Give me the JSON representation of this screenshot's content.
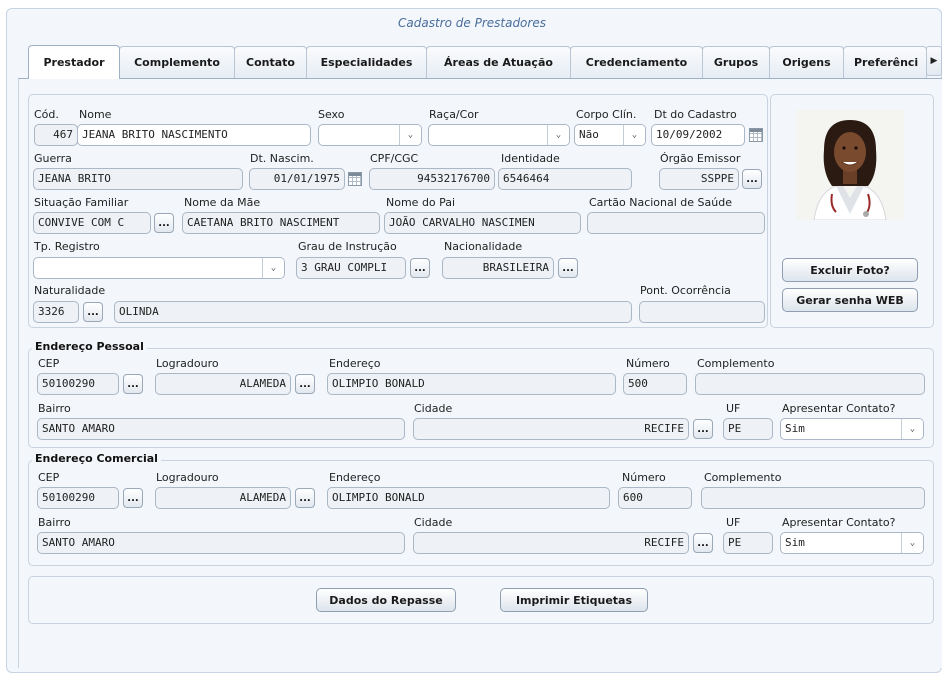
{
  "title": "Cadastro de Prestadores",
  "tabs": [
    "Prestador",
    "Complemento",
    "Contato",
    "Especialidades",
    "Áreas de Atuação",
    "Credenciamento",
    "Grupos",
    "Origens",
    "Preferênci"
  ],
  "labels": {
    "cod": "Cód.",
    "nome": "Nome",
    "sexo": "Sexo",
    "raca": "Raça/Cor",
    "corpo": "Corpo Clín.",
    "dt_cadastro": "Dt do Cadastro",
    "guerra": "Guerra",
    "dt_nasc": "Dt. Nascim.",
    "cpf": "CPF/CGC",
    "identidade": "Identidade",
    "orgao": "Órgão Emissor",
    "sit_familiar": "Situação Familiar",
    "nome_mae": "Nome da Mãe",
    "nome_pai": "Nome do Pai",
    "cartao": "Cartão Nacional de Saúde",
    "tp_registro": "Tp. Registro",
    "grau": "Grau de Instrução",
    "nacionalidade": "Nacionalidade",
    "naturalidade": "Naturalidade",
    "pont_ocorrencia": "Pont. Ocorrência",
    "cep": "CEP",
    "logradouro": "Logradouro",
    "endereco": "Endereço",
    "numero": "Número",
    "complemento": "Complemento",
    "bairro": "Bairro",
    "cidade": "Cidade",
    "uf": "UF",
    "apresentar": "Apresentar Contato?"
  },
  "prestador": {
    "cod": "467",
    "nome": "JEANA BRITO NASCIMENTO",
    "sexo": "",
    "raca": "",
    "corpo": "Não",
    "dt_cadastro": "10/09/2002",
    "guerra": "JEANA BRITO",
    "dt_nasc": "01/01/1975",
    "cpf": "94532176700",
    "identidade": "6546464",
    "orgao": "SSPPE",
    "sit_familiar": "CONVIVE COM C",
    "nome_mae": "CAETANA BRITO NASCIMENT",
    "nome_pai": "JOÃO CARVALHO NASCIMEN",
    "cartao": "",
    "tp_registro": "",
    "grau": "3 GRAU COMPLI",
    "nacionalidade": "BRASILEIRA",
    "nat_cod": "3326",
    "nat_nome": "OLINDA",
    "pont_ocorrencia": ""
  },
  "buttons": {
    "excluir_foto": "Excluir Foto?",
    "gerar_senha": "Gerar senha WEB",
    "dados_repasse": "Dados do Repasse",
    "imprimir": "Imprimir Etiquetas",
    "ellipsis": "..."
  },
  "endereco_pessoal": {
    "legend": "Endereço Pessoal",
    "cep": "50100290",
    "logradouro": "ALAMEDA",
    "endereco": "OLIMPIO BONALD",
    "numero": "500",
    "complemento": "",
    "bairro": "SANTO AMARO",
    "cidade": "RECIFE",
    "uf": "PE",
    "apresentar": "Sim"
  },
  "endereco_comercial": {
    "legend": "Endereço Comercial",
    "cep": "50100290",
    "logradouro": "ALAMEDA",
    "endereco": "OLIMPIO BONALD",
    "numero": "600",
    "complemento": "",
    "bairro": "SANTO AMARO",
    "cidade": "RECIFE",
    "uf": "PE",
    "apresentar": "Sim"
  },
  "icons": {
    "dropdown": "chevron-down-icon",
    "calendar": "calendar-icon",
    "tab_scroll": "chevron-right-icon"
  },
  "colors": {
    "title": "#4a6e9c",
    "background": "#f3f6fa",
    "border": "#aab7c6"
  }
}
